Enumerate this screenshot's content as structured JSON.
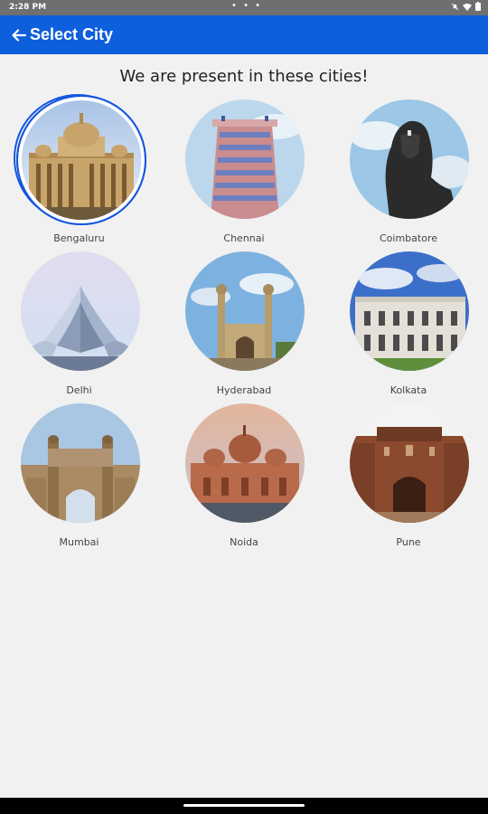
{
  "status_bar": {
    "time": "2:28 PM",
    "dots": "• • •"
  },
  "app_bar": {
    "back_icon": "arrow-left-icon",
    "title": "Select City"
  },
  "heading": "We are present in these cities!",
  "selected_city": "Bengaluru",
  "cities": [
    {
      "name": "Bengaluru"
    },
    {
      "name": "Chennai"
    },
    {
      "name": "Coimbatore"
    },
    {
      "name": "Delhi"
    },
    {
      "name": "Hyderabad"
    },
    {
      "name": "Kolkata"
    },
    {
      "name": "Mumbai"
    },
    {
      "name": "Noida"
    },
    {
      "name": "Pune"
    }
  ],
  "colors": {
    "app_bar": "#0d5fdc",
    "selection_ring": "#1556e0",
    "background": "#f1f1f1"
  }
}
